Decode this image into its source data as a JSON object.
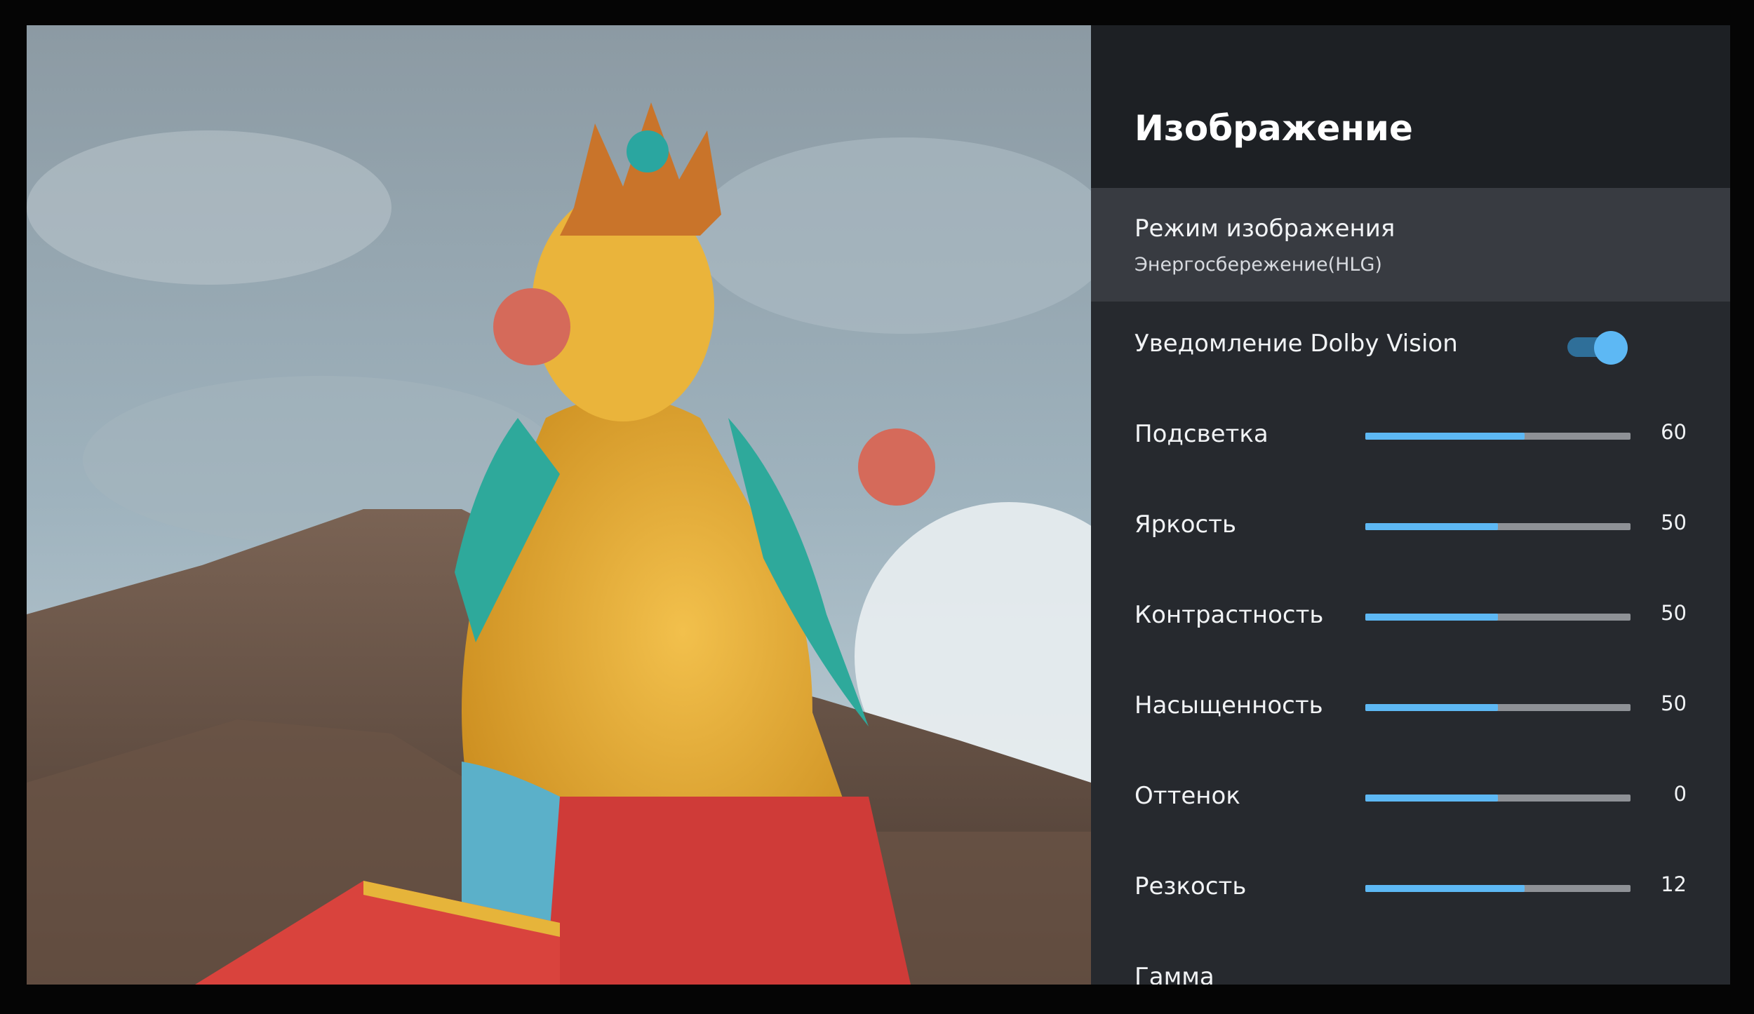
{
  "panel": {
    "title": "Изображение",
    "picture_mode": {
      "label": "Режим изображения",
      "value": "Энергосбережение(HLG)"
    },
    "dolby_notification": {
      "label": "Уведомление Dolby Vision",
      "enabled": true
    },
    "sliders": [
      {
        "label": "Подсветка",
        "value": "60",
        "fraction": 0.6
      },
      {
        "label": "Яркость",
        "value": "50",
        "fraction": 0.5
      },
      {
        "label": "Контрастность",
        "value": "50",
        "fraction": 0.5
      },
      {
        "label": "Насыщенность",
        "value": "50",
        "fraction": 0.5
      },
      {
        "label": "Оттенок",
        "value": "0",
        "fraction": 0.5
      },
      {
        "label": "Резкость",
        "value": "12",
        "fraction": 0.6
      }
    ],
    "gamma": {
      "label": "Гамма"
    }
  },
  "colors": {
    "accent": "#5db8f4",
    "panel_bg": "#26292e",
    "header_bg": "#1d2024",
    "selected_bg": "#383b41"
  }
}
